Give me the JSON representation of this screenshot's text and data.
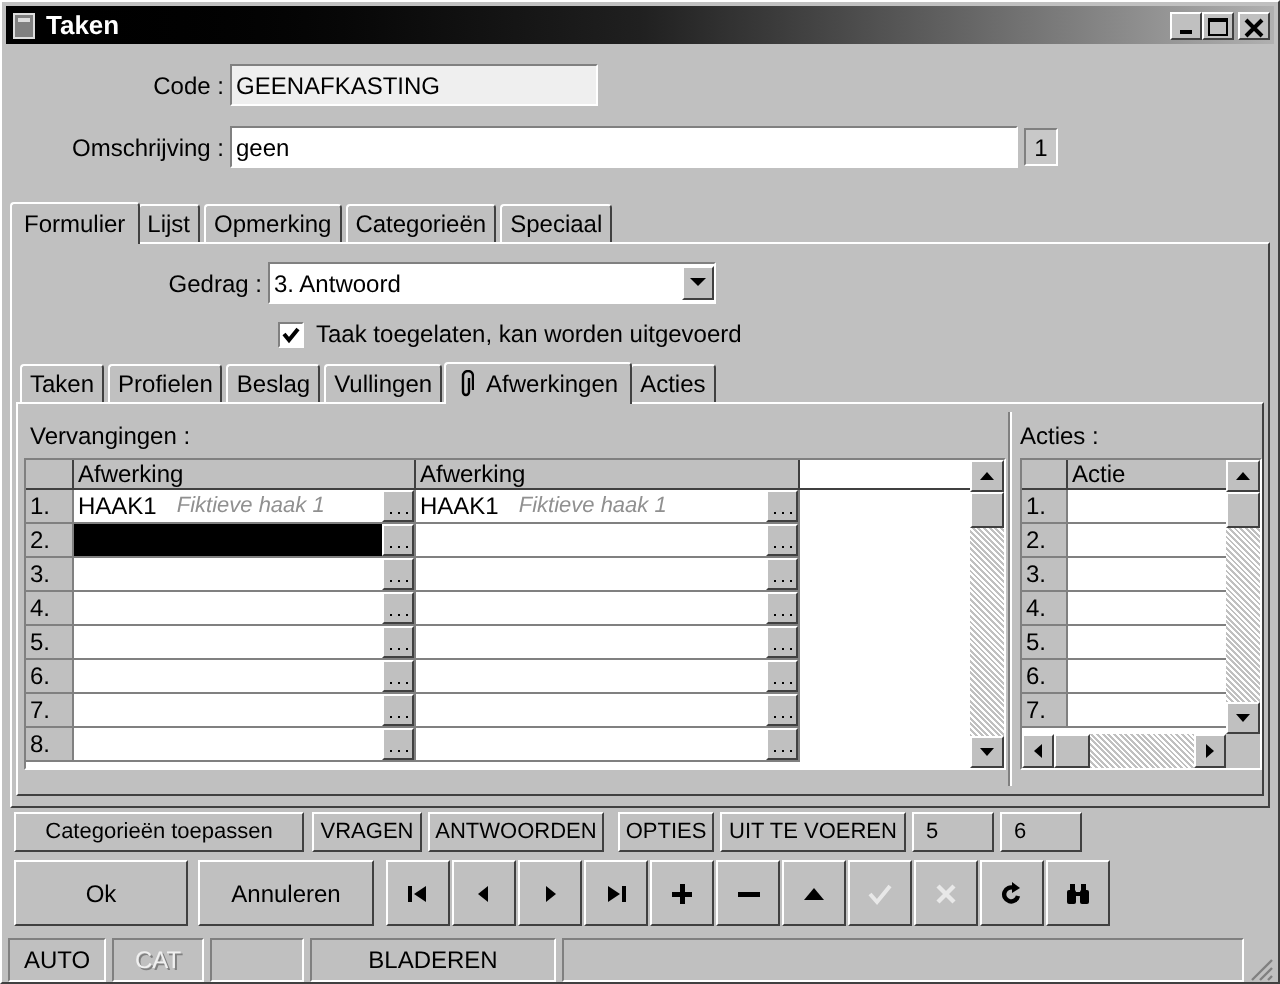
{
  "window": {
    "title": "Taken"
  },
  "fields": [
    {
      "label": "Code :",
      "value": "GEENAFKASTING",
      "readonly": true
    },
    {
      "label": "Omschrijving :",
      "value": "geen",
      "readonly": false,
      "counter": "1"
    }
  ],
  "tabs": [
    {
      "label": "Formulier",
      "selected": true
    },
    {
      "label": "Lijst",
      "selected": false
    },
    {
      "label": "Opmerking",
      "selected": false
    },
    {
      "label": "Categorieën",
      "selected": false
    },
    {
      "label": "Speciaal",
      "selected": false
    }
  ],
  "gedrag": {
    "label": "Gedrag :",
    "value": "3.  Antwoord"
  },
  "checkbox": {
    "label": "Taak toegelaten, kan worden uitgevoerd",
    "checked": true
  },
  "subtabs": [
    {
      "label": "Taken",
      "selected": false,
      "kind": "plain"
    },
    {
      "label": "Profielen",
      "selected": false,
      "kind": "plain"
    },
    {
      "label": "Beslag",
      "selected": false,
      "kind": "plain"
    },
    {
      "label": "Vullingen",
      "selected": false,
      "kind": "plain"
    },
    {
      "label": "Afwerkingen",
      "selected": true,
      "kind": "attachment"
    },
    {
      "label": "Acties",
      "selected": false,
      "kind": "plain"
    }
  ],
  "replacements": {
    "title": "Vervangingen :",
    "columns": [
      "Afwerking",
      "Afwerking"
    ],
    "rows": [
      {
        "number": "1.",
        "cells": [
          {
            "code": "HAAK1",
            "description": "Fiktieve haak 1",
            "selected": false
          },
          {
            "code": "HAAK1",
            "description": "Fiktieve haak 1",
            "selected": false
          }
        ]
      },
      {
        "number": "2.",
        "cells": [
          {
            "selected": true
          },
          {
            "selected": false
          }
        ]
      },
      {
        "number": "3.",
        "cells": [
          {
            "selected": false
          },
          {
            "selected": false
          }
        ]
      },
      {
        "number": "4.",
        "cells": [
          {
            "selected": false
          },
          {
            "selected": false
          }
        ]
      },
      {
        "number": "5.",
        "cells": [
          {
            "selected": false
          },
          {
            "selected": false
          }
        ]
      },
      {
        "number": "6.",
        "cells": [
          {
            "selected": false
          },
          {
            "selected": false
          }
        ]
      },
      {
        "number": "7.",
        "cells": [
          {
            "selected": false
          },
          {
            "selected": false
          }
        ]
      },
      {
        "number": "8.",
        "cells": [
          {
            "selected": false
          },
          {
            "selected": false
          }
        ]
      }
    ]
  },
  "actions": {
    "title": "Acties :",
    "columns": [
      "Actie"
    ],
    "rows": [
      "1.",
      "2.",
      "3.",
      "4.",
      "5.",
      "6.",
      "7."
    ]
  },
  "category_buttons": [
    "Categorieën toepassen",
    "VRAGEN",
    "ANTWOORDEN",
    "OPTIES",
    "UIT TE VOEREN",
    "5",
    "6"
  ],
  "buttons": [
    "Ok",
    "Annuleren"
  ],
  "toolbar": [
    {
      "kind": "first",
      "disabled": false
    },
    {
      "kind": "prev",
      "disabled": false
    },
    {
      "kind": "next",
      "disabled": false
    },
    {
      "kind": "last",
      "disabled": false
    },
    {
      "kind": "add",
      "disabled": false
    },
    {
      "kind": "remove",
      "disabled": false
    },
    {
      "kind": "up",
      "disabled": false
    },
    {
      "kind": "confirm",
      "disabled": true
    },
    {
      "kind": "cancel",
      "disabled": true
    },
    {
      "kind": "refresh",
      "disabled": false
    },
    {
      "kind": "find",
      "disabled": false
    }
  ],
  "status_bar": [
    {
      "text": "AUTO",
      "disabled": false
    },
    {
      "text": "CAT",
      "disabled": true
    },
    {
      "text": "BLADEREN",
      "disabled": false
    }
  ]
}
